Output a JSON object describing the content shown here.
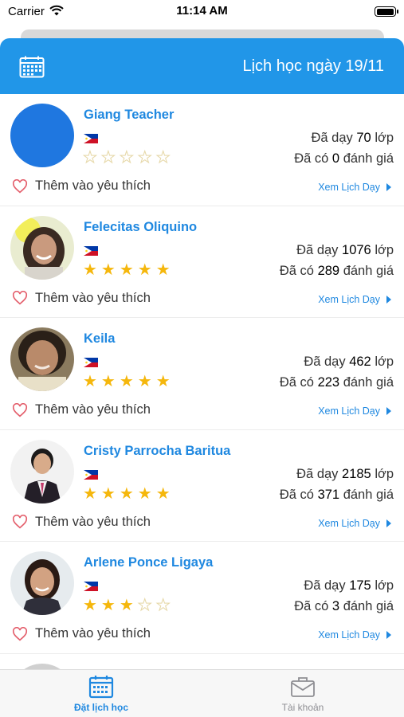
{
  "status_bar": {
    "carrier": "Carrier",
    "time": "11:14 AM"
  },
  "header": {
    "title": "Lịch học ngày 19/11",
    "calendar_icon": "calendar-icon",
    "color": "#2196e8"
  },
  "labels": {
    "taught_prefix": "Đã dạy",
    "taught_suffix": "lớp",
    "reviews_prefix": "Đã có",
    "reviews_suffix": "đánh giá",
    "favorite": "Thêm vào yêu thích",
    "view_schedule": "Xem Lịch Dạy"
  },
  "teachers": [
    {
      "name": "Giang Teacher",
      "country_flag": "philippines-flag",
      "rating": 0,
      "classes": "70",
      "reviews": "0"
    },
    {
      "name": "Felecitas Oliquino",
      "country_flag": "philippines-flag",
      "rating": 5,
      "classes": "1076",
      "reviews": "289"
    },
    {
      "name": "Keila",
      "country_flag": "philippines-flag",
      "rating": 5,
      "classes": "462",
      "reviews": "223"
    },
    {
      "name": "Cristy Parrocha Baritua",
      "country_flag": "philippines-flag",
      "rating": 5,
      "classes": "2185",
      "reviews": "371"
    },
    {
      "name": "Arlene Ponce Ligaya",
      "country_flag": "philippines-flag",
      "rating": 3,
      "classes": "175",
      "reviews": "3"
    }
  ],
  "tabbar": {
    "tabs": [
      {
        "label": "Đặt lịch học",
        "icon": "calendar-icon",
        "active": true
      },
      {
        "label": "Tài khoản",
        "icon": "briefcase-icon",
        "active": false
      }
    ]
  },
  "colors": {
    "accent": "#1f88e0",
    "star": "#f5b70c",
    "heart": "#e4606d"
  }
}
